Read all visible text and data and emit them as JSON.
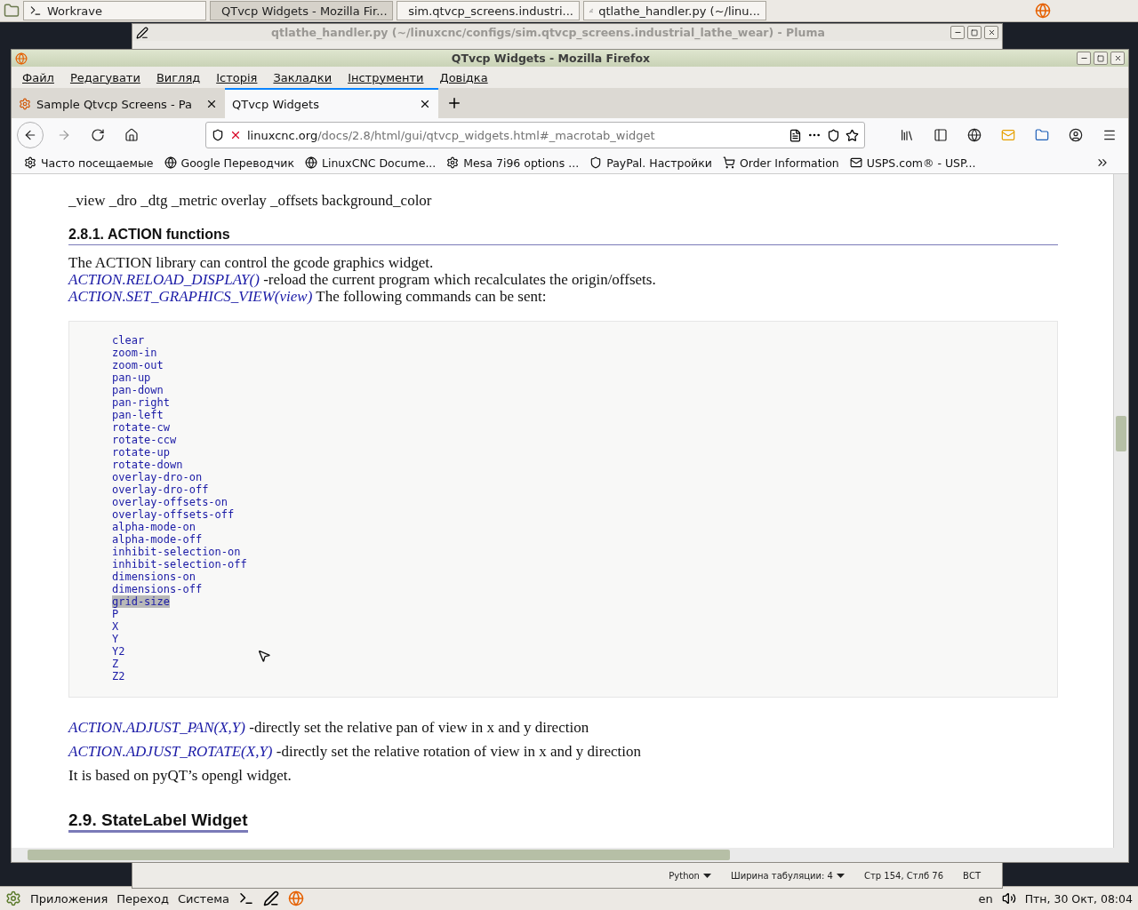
{
  "top_panel": {
    "tasks": [
      {
        "label": "Workrave",
        "selected": false
      },
      {
        "label": "QTvcp Widgets - Mozilla Fir...",
        "selected": true
      },
      {
        "label": "sim.qtvcp_screens.industri...",
        "selected": false
      },
      {
        "label": "qtlathe_handler.py (~/linu...",
        "selected": false
      }
    ]
  },
  "pluma": {
    "title": "qtlathe_handler.py (~/linuxcnc/configs/sim.qtvcp_screens.industrial_lathe_wear) - Pluma",
    "status_bar": {
      "language": "Python",
      "tab_width": "Ширина табуляции:  4",
      "position": "Стр 154, Стлб 76",
      "mode": "ВСТ"
    }
  },
  "firefox": {
    "title": "QTvcp Widgets - Mozilla Firefox",
    "menu": [
      "Файл",
      "Редагувати",
      "Вигляд",
      "Історія",
      "Закладки",
      "Інструменти",
      "Довідка"
    ],
    "tabs": [
      {
        "label": "Sample Qtvcp Screens - Pa",
        "selected": false
      },
      {
        "label": "QTvcp Widgets",
        "selected": true
      }
    ],
    "url": {
      "domain": "linuxcnc.org",
      "path": "/docs/2.8/html/gui/qtvcp_widgets.html#_macrotab_widget"
    },
    "bookmarks": [
      "Часто посещаемые",
      "Google Переводчик",
      "LinuxCNC Docume...",
      "Mesa 7i96 options ...",
      "PayPal. Настройки",
      "Order Information",
      "USPS.com® - USP..."
    ],
    "page": {
      "properties_line": "_view _dro _dtg _metric overlay _offsets background_color",
      "section_heading": "2.8.1. ACTION functions",
      "intro": "The ACTION library can control the gcode graphics widget.",
      "actions": [
        {
          "code": "ACTION.RELOAD_DISPLAY()",
          "text": " -reload the current program which recalculates the origin/offsets."
        },
        {
          "code": "ACTION.SET_GRAPHICS_VIEW(view)",
          "text": " The following commands can be sent:"
        }
      ],
      "commands": [
        {
          "text": "clear",
          "selected": false
        },
        {
          "text": "zoom-in",
          "selected": false
        },
        {
          "text": "zoom-out",
          "selected": false
        },
        {
          "text": "pan-up",
          "selected": false
        },
        {
          "text": "pan-down",
          "selected": false
        },
        {
          "text": "pan-right",
          "selected": false
        },
        {
          "text": "pan-left",
          "selected": false
        },
        {
          "text": "rotate-cw",
          "selected": false
        },
        {
          "text": "rotate-ccw",
          "selected": false
        },
        {
          "text": "rotate-up",
          "selected": false
        },
        {
          "text": "rotate-down",
          "selected": false
        },
        {
          "text": "overlay-dro-on",
          "selected": false
        },
        {
          "text": "overlay-dro-off",
          "selected": false
        },
        {
          "text": "overlay-offsets-on",
          "selected": false
        },
        {
          "text": "overlay-offsets-off",
          "selected": false
        },
        {
          "text": "alpha-mode-on",
          "selected": false
        },
        {
          "text": "alpha-mode-off",
          "selected": false
        },
        {
          "text": "inhibit-selection-on",
          "selected": false
        },
        {
          "text": "inhibit-selection-off",
          "selected": false
        },
        {
          "text": "dimensions-on",
          "selected": false
        },
        {
          "text": "dimensions-off",
          "selected": false
        },
        {
          "text": "grid-size",
          "selected": true
        },
        {
          "text": "P",
          "selected": false
        },
        {
          "text": "X",
          "selected": false
        },
        {
          "text": "Y",
          "selected": false
        },
        {
          "text": "Y2",
          "selected": false
        },
        {
          "text": "Z",
          "selected": false
        },
        {
          "text": "Z2",
          "selected": false
        }
      ],
      "more_actions": [
        {
          "code": "ACTION.ADJUST_PAN(X,Y)",
          "text": " -directly set the relative pan of view in x and y direction"
        },
        {
          "code": "ACTION.ADJUST_ROTATE(X,Y)",
          "text": " -directly set the relative rotation of view in x and y direction"
        }
      ],
      "note": "It is based on pyQT’s opengl widget.",
      "next_heading": "2.9. StateLabel Widget"
    }
  },
  "bottom_panel": {
    "menus": [
      "Приложения",
      "Переход",
      "Система"
    ],
    "language": "en",
    "clock": "Птн, 30 Окт, 08:04"
  }
}
